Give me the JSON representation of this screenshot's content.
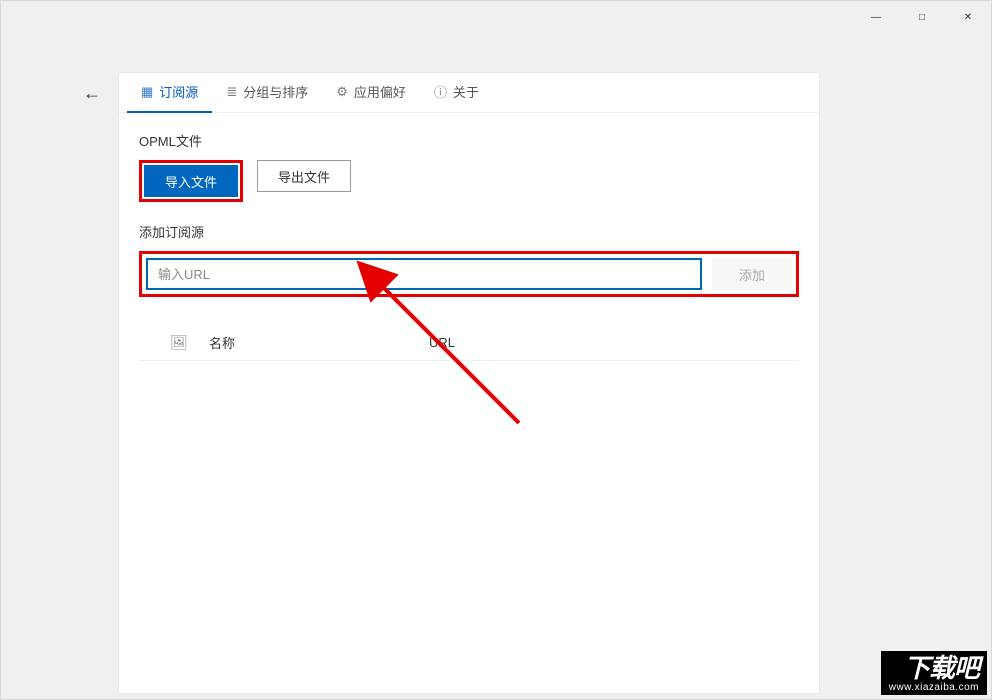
{
  "window": {
    "minimize_glyph": "—",
    "maximize_glyph": "□",
    "close_glyph": "✕"
  },
  "nav": {
    "back_glyph": "←"
  },
  "tabs": {
    "feeds": {
      "label": "订阅源",
      "icon": "▦"
    },
    "groups": {
      "label": "分组与排序",
      "icon": "≣"
    },
    "prefs": {
      "label": "应用偏好",
      "icon": "⚙"
    },
    "about": {
      "label": "关于",
      "icon": "ⓘ"
    }
  },
  "opml": {
    "section_label": "OPML文件",
    "import_label": "导入文件",
    "export_label": "导出文件"
  },
  "addfeed": {
    "section_label": "添加订阅源",
    "url_placeholder": "输入URL",
    "url_value": "",
    "add_label": "添加"
  },
  "list": {
    "icon_glyph": "🖼",
    "col_name": "名称",
    "col_url": "URL"
  },
  "watermark": {
    "big": "下载吧",
    "small": "www.xiazaiba.com"
  },
  "annotations": {
    "arrow_from": "below-right",
    "arrow_to": "url-input",
    "highlighted": [
      "import-button",
      "addfeed-row"
    ]
  }
}
